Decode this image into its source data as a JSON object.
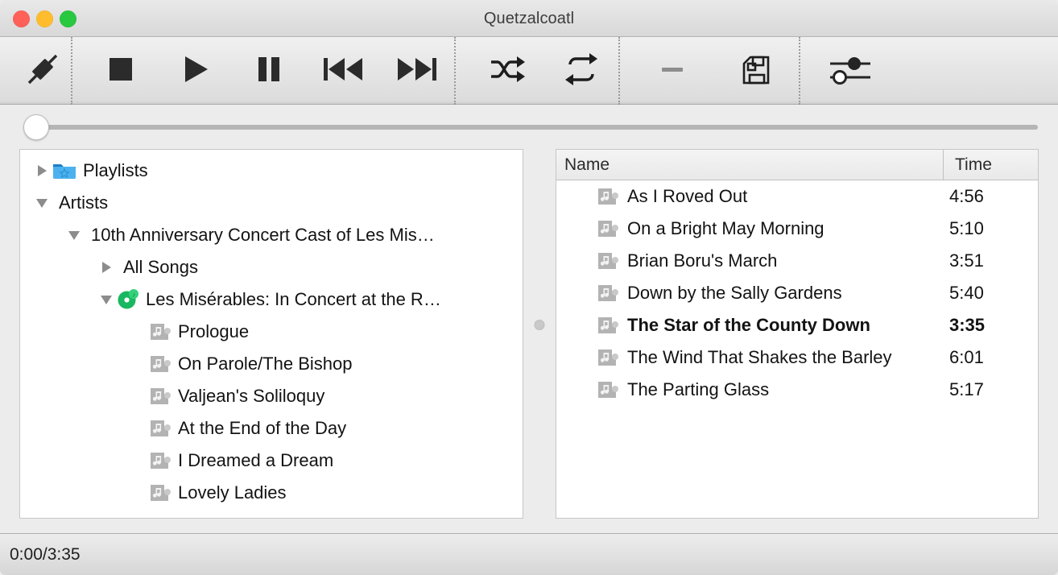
{
  "window": {
    "title": "Quetzalcoatl",
    "traffic_lights": [
      {
        "name": "close-button",
        "color": "#ff6159"
      },
      {
        "name": "minimize-button",
        "color": "#ffbd2e"
      },
      {
        "name": "zoom-button",
        "color": "#28c840"
      }
    ]
  },
  "toolbar": {
    "buttons": [
      {
        "id": "eject",
        "icon": "eject-plug-icon",
        "label": "Eject"
      },
      {
        "id": "stop",
        "icon": "stop-icon",
        "label": "Stop"
      },
      {
        "id": "play",
        "icon": "play-icon",
        "label": "Play"
      },
      {
        "id": "pause",
        "icon": "pause-icon",
        "label": "Pause"
      },
      {
        "id": "previous",
        "icon": "previous-track-icon",
        "label": "Previous"
      },
      {
        "id": "next",
        "icon": "next-track-icon",
        "label": "Next"
      },
      {
        "id": "shuffle",
        "icon": "shuffle-icon",
        "label": "Shuffle"
      },
      {
        "id": "repeat",
        "icon": "repeat-icon",
        "label": "Repeat"
      },
      {
        "id": "minus",
        "icon": "minus-icon",
        "label": "Remove"
      },
      {
        "id": "save",
        "icon": "floppy-disk-icon",
        "label": "Save"
      },
      {
        "id": "settings",
        "icon": "equalizer-sliders-icon",
        "label": "Settings"
      }
    ]
  },
  "seek": {
    "value": 0,
    "min": 0,
    "max": 215
  },
  "tree": {
    "rows": [
      {
        "indent": 0,
        "twisty": "closed",
        "icon": "blue-star-folder-icon",
        "label": "Playlists"
      },
      {
        "indent": 0,
        "twisty": "open",
        "icon": "none",
        "label": "Artists"
      },
      {
        "indent": 1,
        "twisty": "open",
        "icon": "none",
        "label": "10th Anniversary Concert Cast of Les Mis…"
      },
      {
        "indent": 2,
        "twisty": "closed",
        "icon": "none",
        "label": "All Songs"
      },
      {
        "indent": 2,
        "twisty": "open",
        "icon": "green-disc-icon",
        "label": "Les Misérables: In Concert at the R…"
      },
      {
        "indent": 3,
        "twisty": "none",
        "icon": "music-file-icon",
        "label": "Prologue"
      },
      {
        "indent": 3,
        "twisty": "none",
        "icon": "music-file-icon",
        "label": "On Parole/The Bishop"
      },
      {
        "indent": 3,
        "twisty": "none",
        "icon": "music-file-icon",
        "label": "Valjean's Soliloquy"
      },
      {
        "indent": 3,
        "twisty": "none",
        "icon": "music-file-icon",
        "label": "At the End of the Day"
      },
      {
        "indent": 3,
        "twisty": "none",
        "icon": "music-file-icon",
        "label": "I Dreamed a Dream"
      },
      {
        "indent": 3,
        "twisty": "none",
        "icon": "music-file-icon",
        "label": "Lovely Ladies"
      }
    ]
  },
  "tracklist": {
    "columns": {
      "name": "Name",
      "time": "Time"
    },
    "rows": [
      {
        "icon": "music-file-icon",
        "name": "As I Roved Out",
        "time": "4:56",
        "playing": false
      },
      {
        "icon": "music-file-icon",
        "name": "On a Bright May Morning",
        "time": "5:10",
        "playing": false
      },
      {
        "icon": "music-file-icon",
        "name": "Brian Boru's March",
        "time": "3:51",
        "playing": false
      },
      {
        "icon": "music-file-icon",
        "name": "Down by the Sally Gardens",
        "time": "5:40",
        "playing": false
      },
      {
        "icon": "music-file-icon",
        "name": "The Star of the County Down",
        "time": "3:35",
        "playing": true
      },
      {
        "icon": "music-file-icon",
        "name": "The Wind That Shakes the Barley",
        "time": "6:01",
        "playing": false
      },
      {
        "icon": "music-file-icon",
        "name": "The Parting Glass",
        "time": "5:17",
        "playing": false
      }
    ]
  },
  "statusbar": {
    "time": "0:00/3:35"
  },
  "colors": {
    "folder_blue": "#41a6e8",
    "disc_green": "#1fbf68",
    "file_gray": "#b0b0b0",
    "accent_text": "#131313"
  }
}
